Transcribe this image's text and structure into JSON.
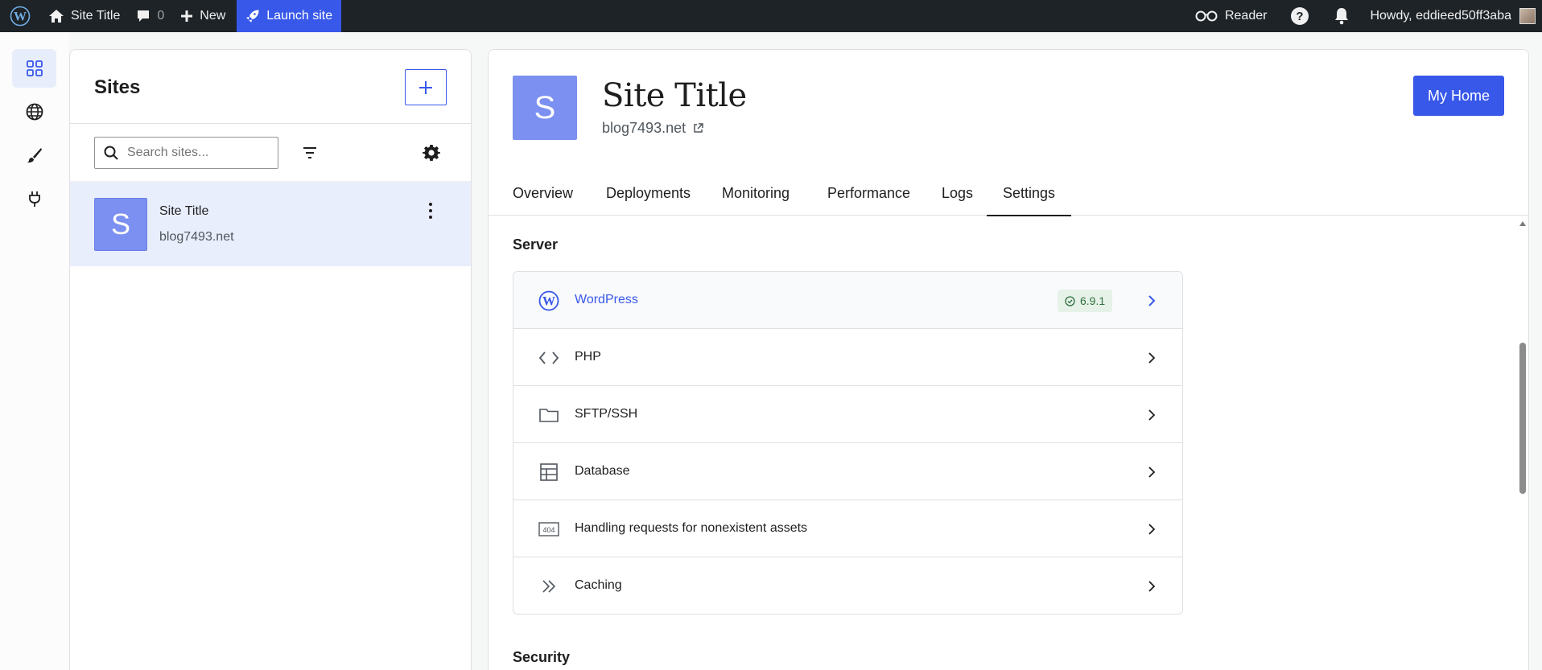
{
  "adminbar": {
    "wp_logo_icon": "wordpress-logo",
    "site_title": "Site Title",
    "comments_count": "0",
    "new_label": "New",
    "launch_label": "Launch site",
    "reader_label": "Reader",
    "howdy_label": "Howdy, eddieed50ff3aba"
  },
  "rail": {
    "items": [
      {
        "icon": "dashboard-grid-icon",
        "active": true
      },
      {
        "icon": "globe-icon"
      },
      {
        "icon": "brush-icon"
      },
      {
        "icon": "plug-icon"
      }
    ]
  },
  "sites_panel": {
    "title": "Sites",
    "search_placeholder": "Search sites...",
    "sites": [
      {
        "initial": "S",
        "name": "Site Title",
        "domain": "blog7493.net"
      }
    ]
  },
  "site_header": {
    "initial": "S",
    "title": "Site Title",
    "domain": "blog7493.net",
    "my_home_label": "My Home"
  },
  "tabs": [
    {
      "label": "Overview"
    },
    {
      "label": "Deployments"
    },
    {
      "label": "Monitoring"
    },
    {
      "label": "Performance"
    },
    {
      "label": "Logs"
    },
    {
      "label": "Settings",
      "active": true
    }
  ],
  "server_section": {
    "title": "Server",
    "rows": [
      {
        "label": "WordPress",
        "icon": "wordpress-icon",
        "badge": "6.9.1"
      },
      {
        "label": "PHP",
        "icon": "code-icon"
      },
      {
        "label": "SFTP/SSH",
        "icon": "folder-icon"
      },
      {
        "label": "Database",
        "icon": "table-icon"
      },
      {
        "label": "Handling requests for nonexistent assets",
        "icon": "404-icon",
        "icon_text": "404"
      },
      {
        "label": "Caching",
        "icon": "chevrons-right-icon"
      }
    ]
  },
  "security_section": {
    "title": "Security"
  },
  "colors": {
    "accent": "#3858e9",
    "adminbar": "#1d2327",
    "avatar": "#7b90f0"
  }
}
